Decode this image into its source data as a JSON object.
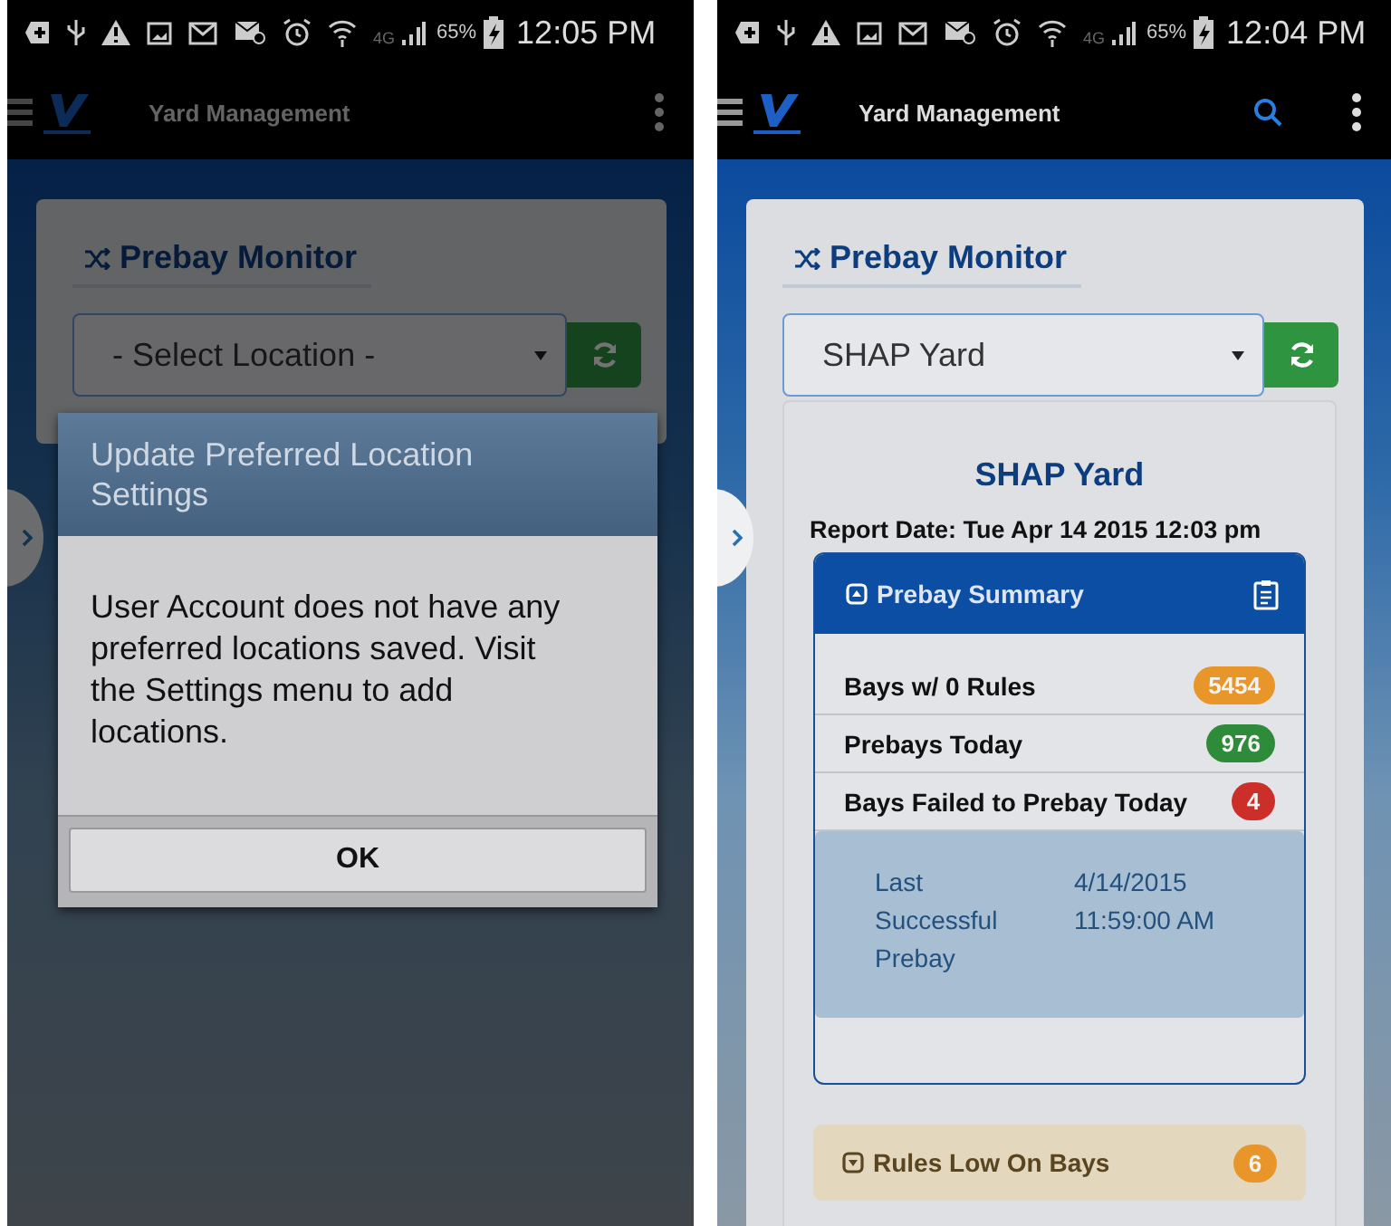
{
  "screens": [
    {
      "status_bar": {
        "network": "4G",
        "battery": "65%",
        "time": "12:05 PM"
      },
      "app_bar": {
        "title": "Yard Management",
        "search_icon": false
      },
      "monitor": {
        "title": "Prebay Monitor",
        "location_select": {
          "value": "- Select Location -"
        }
      },
      "dialog": {
        "title": "Update Preferred Location Settings",
        "message": "User Account does not have any preferred locations saved. Visit the Settings menu to add locations.",
        "button": "OK"
      }
    },
    {
      "status_bar": {
        "network": "4G",
        "battery": "65%",
        "time": "12:04 PM"
      },
      "app_bar": {
        "title": "Yard Management",
        "search_icon": true
      },
      "monitor": {
        "title": "Prebay Monitor",
        "location_select": {
          "value": "SHAP Yard"
        },
        "report": {
          "yard": "SHAP Yard",
          "report_date": "Report Date: Tue Apr 14 2015 12:03 pm",
          "summary": {
            "title": "Prebay Summary",
            "expanded": true,
            "rows": [
              {
                "label": "Bays w/ 0 Rules",
                "count": "5454",
                "color": "#e8962a"
              },
              {
                "label": "Prebays Today",
                "count": "976",
                "color": "#2e8b3a"
              },
              {
                "label": "Bays Failed to Prebay Today",
                "count": "4",
                "color": "#cc2e2a"
              }
            ],
            "last_label": "Last Successful Prebay",
            "last_value": "4/14/2015 11:59:00 AM"
          },
          "rules_low": {
            "title": "Rules Low On Bays",
            "count": "6",
            "color": "#e8962a",
            "expanded": false
          }
        }
      }
    }
  ]
}
